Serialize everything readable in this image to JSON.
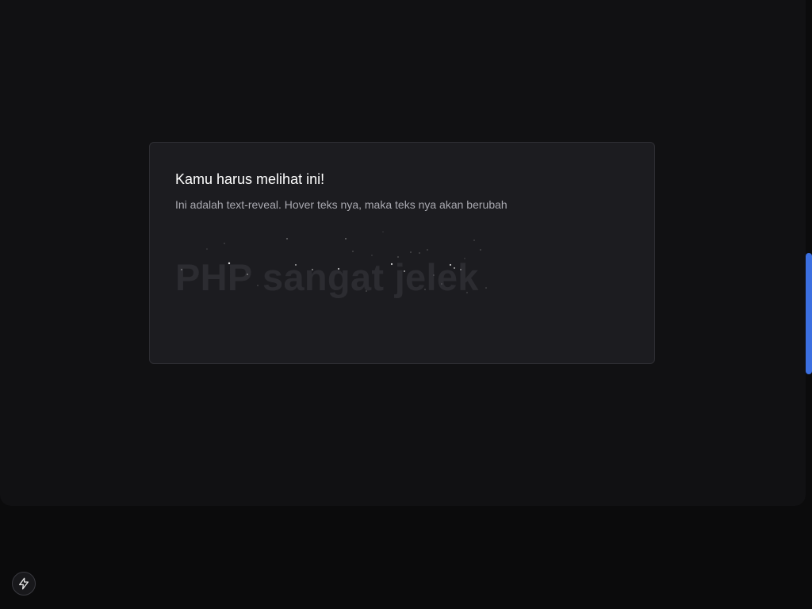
{
  "card": {
    "title": "Kamu harus melihat ini!",
    "description": "Ini adalah text-reveal. Hover teks nya, maka teks nya akan berubah",
    "reveal_text": "PHP sangat jelek"
  },
  "icons": {
    "devtools": "lightning-bolt-icon"
  },
  "colors": {
    "page_background": "#0b0b0c",
    "panel_background": "#111113",
    "card_background": "#1c1c20",
    "card_border": "#2e2e33",
    "title_text": "#ffffff",
    "description_text": "#a9a9b0",
    "reveal_text": "#2c2c31",
    "scrollbar_thumb": "#3b6fe0"
  }
}
